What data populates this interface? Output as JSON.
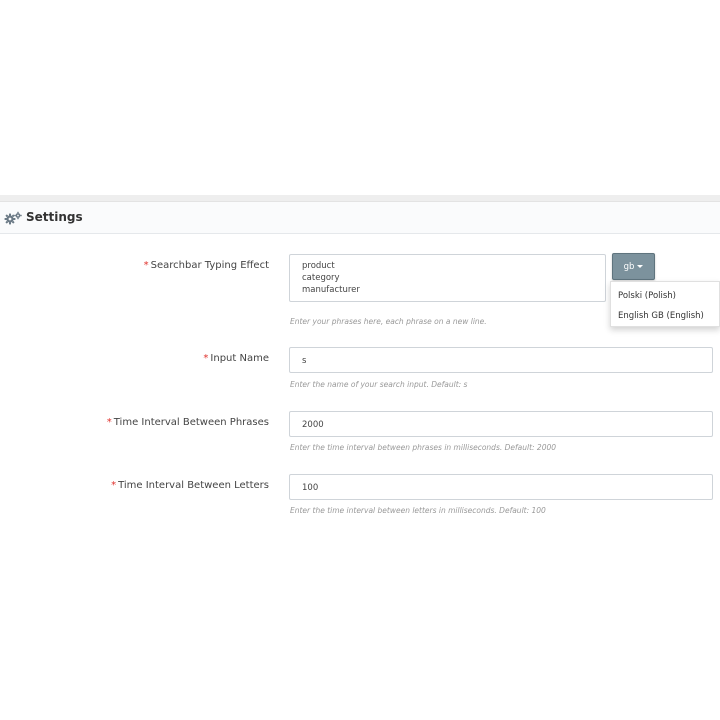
{
  "settings": {
    "title": "Settings",
    "icon": "gears-icon"
  },
  "fields": {
    "typing_effect": {
      "required_mark": "*",
      "label": "Searchbar Typing Effect",
      "lines": [
        "product",
        "category",
        "manufacturer"
      ],
      "help": "Enter your phrases here, each phrase on a new line."
    },
    "input_name": {
      "required_mark": "*",
      "label": "Input Name",
      "value": "s",
      "help": "Enter the name of your search input. Default: s"
    },
    "phrase_interval": {
      "required_mark": "*",
      "label": "Time Interval Between Phrases",
      "value": "2000",
      "help": "Enter the time interval between phrases in milliseconds. Default: 2000"
    },
    "letter_interval": {
      "required_mark": "*",
      "label": "Time Interval Between Letters",
      "value": "100",
      "help": "Enter the time interval between letters in milliseconds. Default: 100"
    }
  },
  "language": {
    "selected": "gb",
    "options": [
      "Polski (Polish)",
      "English GB (English)"
    ]
  },
  "colors": {
    "required": "#e0312c",
    "lang_button": "#7c929d"
  }
}
